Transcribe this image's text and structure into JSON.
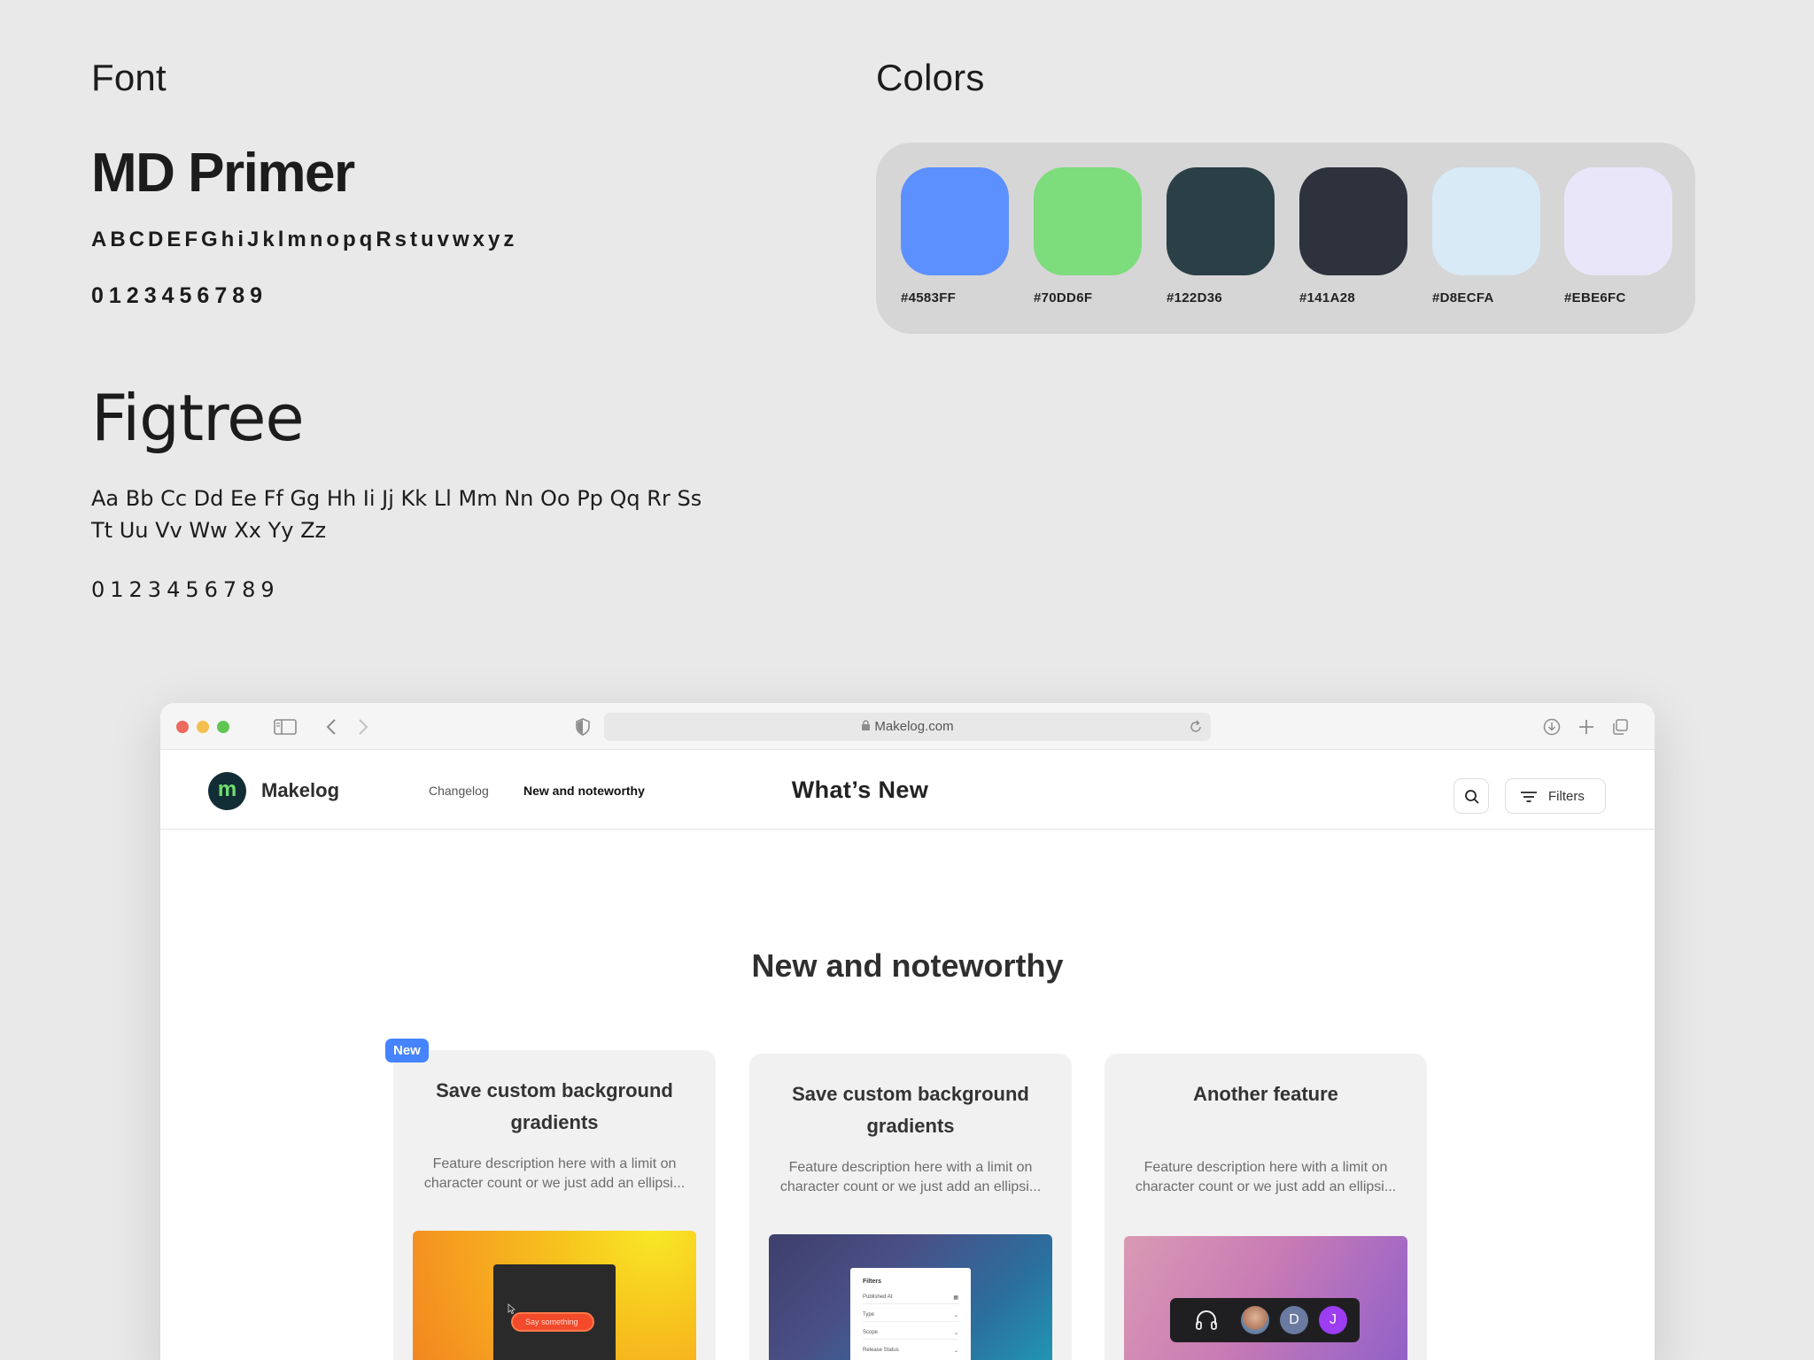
{
  "font_section": {
    "heading": "Font",
    "font1": {
      "name": "MD Primer",
      "alphabet": "ABCDEFGhiJklmnopqRstuvwxyz",
      "digits": "0123456789"
    },
    "font2": {
      "name": "Figtree",
      "alphabet": "Aa Bb Cc Dd Ee Ff Gg Hh Ii Jj Kk Ll Mm Nn Oo Pp Qq Rr Ss Tt Uu Vv Ww Xx Yy Zz",
      "digits": "0123456789"
    }
  },
  "colors_section": {
    "heading": "Colors",
    "swatches": [
      {
        "label": "#4583FF",
        "color": "#5C90FF"
      },
      {
        "label": "#70DD6F",
        "color": "#7DDC7C"
      },
      {
        "label": "#122D36",
        "color": "#2A3F46"
      },
      {
        "label": "#141A28",
        "color": "#2D323D"
      },
      {
        "label": "#D8ECFA",
        "color": "#D8EAF6"
      },
      {
        "label": "#EBE6FC",
        "color": "#EAE6FA"
      }
    ]
  },
  "browser": {
    "url": "Makelog.com",
    "brand": "Makelog",
    "logo_letter": "m",
    "nav": [
      {
        "label": "Changelog",
        "active": false
      },
      {
        "label": "New and noteworthy",
        "active": true
      }
    ],
    "title": "What’s New",
    "filters_label": "Filters",
    "page_heading": "New and noteworthy",
    "cards": [
      {
        "badge": "New",
        "title": "Save custom background gradients",
        "description": "Feature description here with a limit on character count or we just add an ellipsi...",
        "preview_button": "Say something"
      },
      {
        "title": "Save custom background gradients",
        "description": "Feature description here with a limit on character count or we just add an ellipsi...",
        "preview_panel": {
          "heading": "Filters",
          "rows": [
            "Published At",
            "Type",
            "Scope",
            "Release Status"
          ]
        }
      },
      {
        "title": "Another feature",
        "description": "Feature description here with a limit on character count or we just add an ellipsi...",
        "preview_avatars": [
          "D",
          "J"
        ]
      }
    ]
  },
  "colors": {
    "accent": "#4583FF",
    "brand_green": "#70DD6F",
    "brand_dark": "#122D36"
  }
}
